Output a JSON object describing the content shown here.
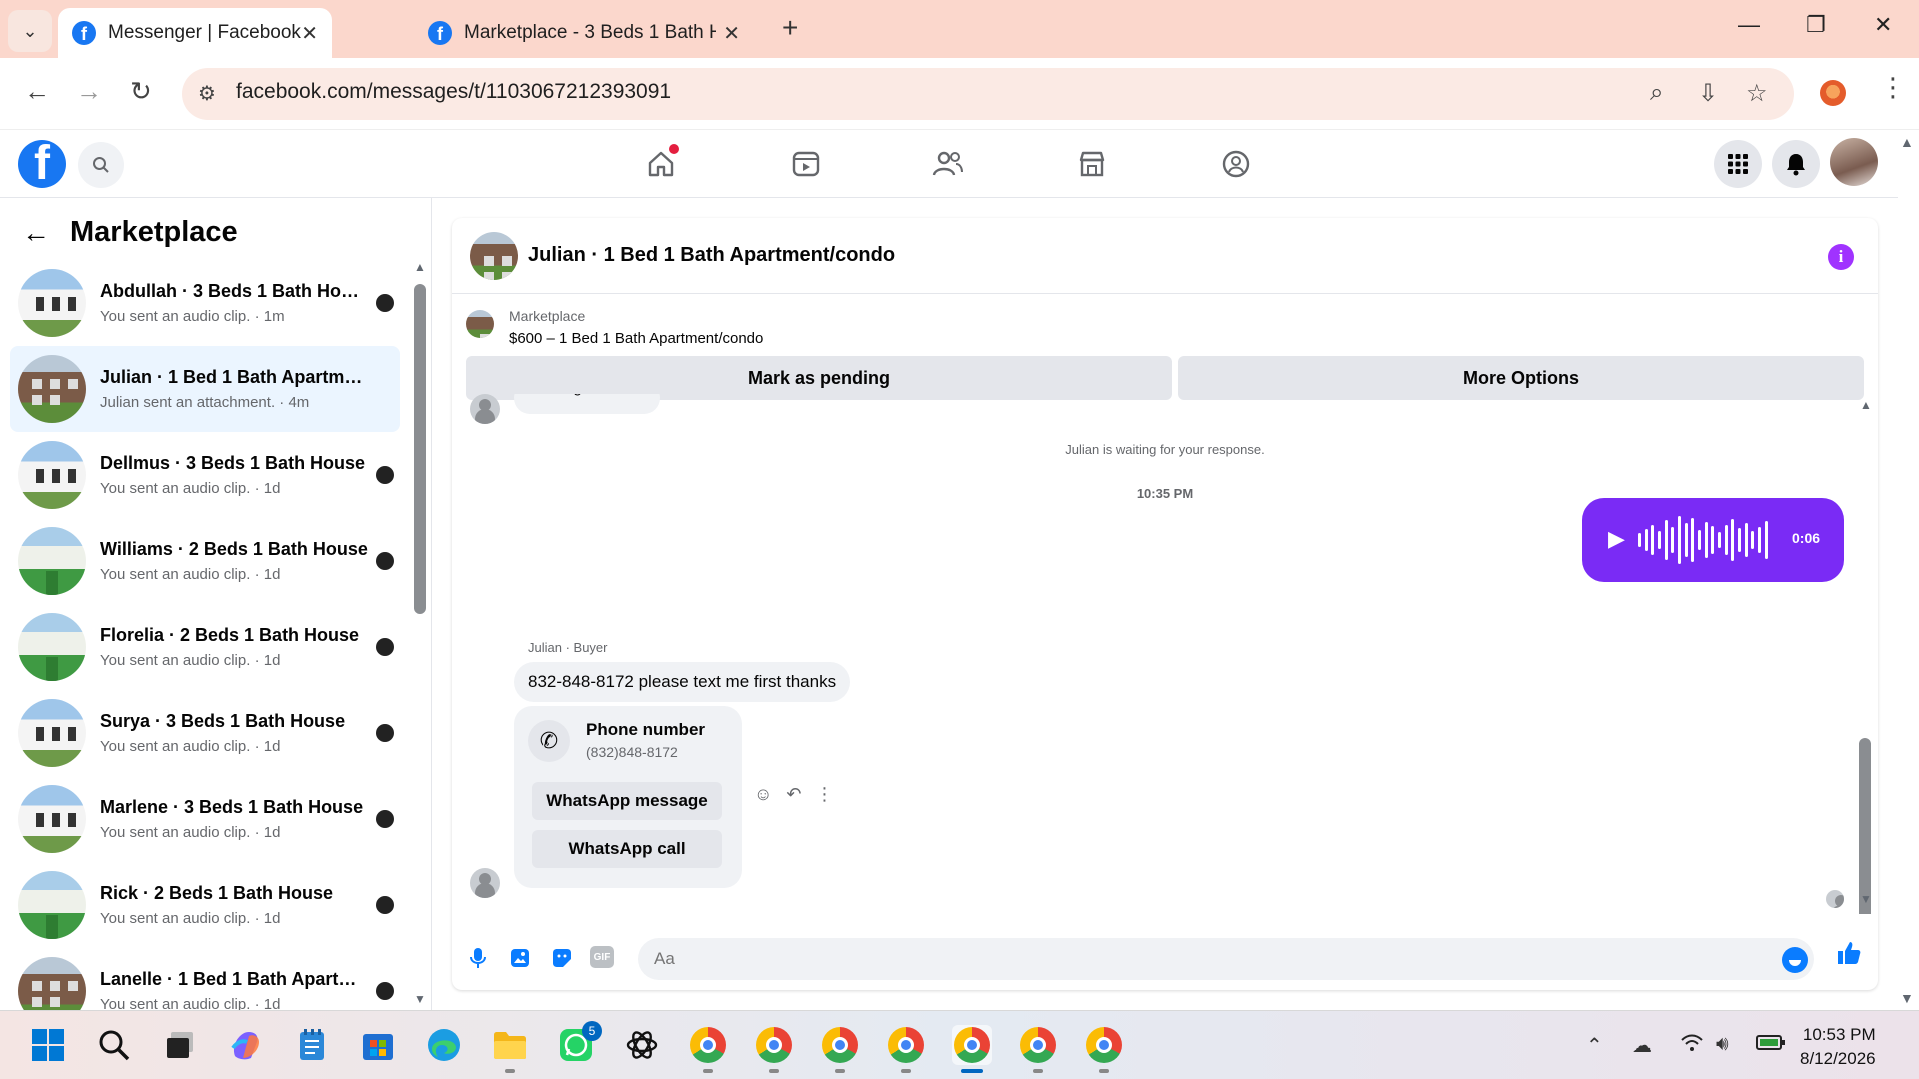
{
  "browser": {
    "tabs": [
      {
        "title": "Messenger | Facebook",
        "active": true
      },
      {
        "title": "Marketplace - 3 Beds 1 Bath Ho",
        "active": false
      }
    ],
    "url": "facebook.com/messages/t/1103067212393091"
  },
  "left": {
    "title": "Marketplace",
    "conversations": [
      {
        "title": "Abdullah · 3 Beds 1 Bath House",
        "subtitle": "You sent an audio clip. · 1m",
        "thumb": "white-house"
      },
      {
        "title": "Julian · 1 Bed 1 Bath Apartment/...",
        "subtitle": "Julian sent an attachment. · 4m",
        "thumb": "apt"
      },
      {
        "title": "Dellmus · 3 Beds 1 Bath House",
        "subtitle": "You sent an audio clip. · 1d",
        "thumb": "white-house"
      },
      {
        "title": "Williams · 2 Beds 1 Bath House",
        "subtitle": "You sent an audio clip. · 1d",
        "thumb": "green-house"
      },
      {
        "title": "Florelia · 2 Beds 1 Bath House",
        "subtitle": "You sent an audio clip. · 1d",
        "thumb": "green-house"
      },
      {
        "title": "Surya · 3 Beds 1 Bath House",
        "subtitle": "You sent an audio clip. · 1d",
        "thumb": "white-house"
      },
      {
        "title": "Marlene · 3 Beds 1 Bath House",
        "subtitle": "You sent an audio clip. · 1d",
        "thumb": "white-house"
      },
      {
        "title": "Rick · 2 Beds 1 Bath House",
        "subtitle": "You sent an audio clip. · 1d",
        "thumb": "green-house"
      },
      {
        "title": "Lanelle · 1 Bed 1 Bath Apartmen...",
        "subtitle": "You sent an audio clip. · 1d",
        "thumb": "apt"
      }
    ]
  },
  "chat": {
    "title": "Julian · 1 Bed 1 Bath Apartment/condo",
    "listing_label": "Marketplace",
    "listing_price": "$600 – 1 Bed 1 Bath Apartment/condo",
    "mark_pending": "Mark as pending",
    "more_options": "More Options",
    "sent_status": "Message sent",
    "waiting": "Julian is waiting for your response.",
    "time": "10:35 PM",
    "audio_duration": "0:06",
    "sender": "Julian · Buyer",
    "message": "832-848-8172 please text me first thanks",
    "phone_title": "Phone number",
    "phone_number": "(832)848-8172",
    "whatsapp_message": "WhatsApp message",
    "whatsapp_call": "WhatsApp call",
    "composer_placeholder": "Aa",
    "gif_label": "GIF"
  },
  "taskbar": {
    "whatsapp_badge": "5",
    "time": "10:53 PM",
    "date": "8/12/2026"
  },
  "colors": {
    "facebook_blue": "#1877f2",
    "messenger_purple": "#7a2bf5",
    "info_purple": "#a033ff",
    "active_row": "#ebf5ff"
  }
}
